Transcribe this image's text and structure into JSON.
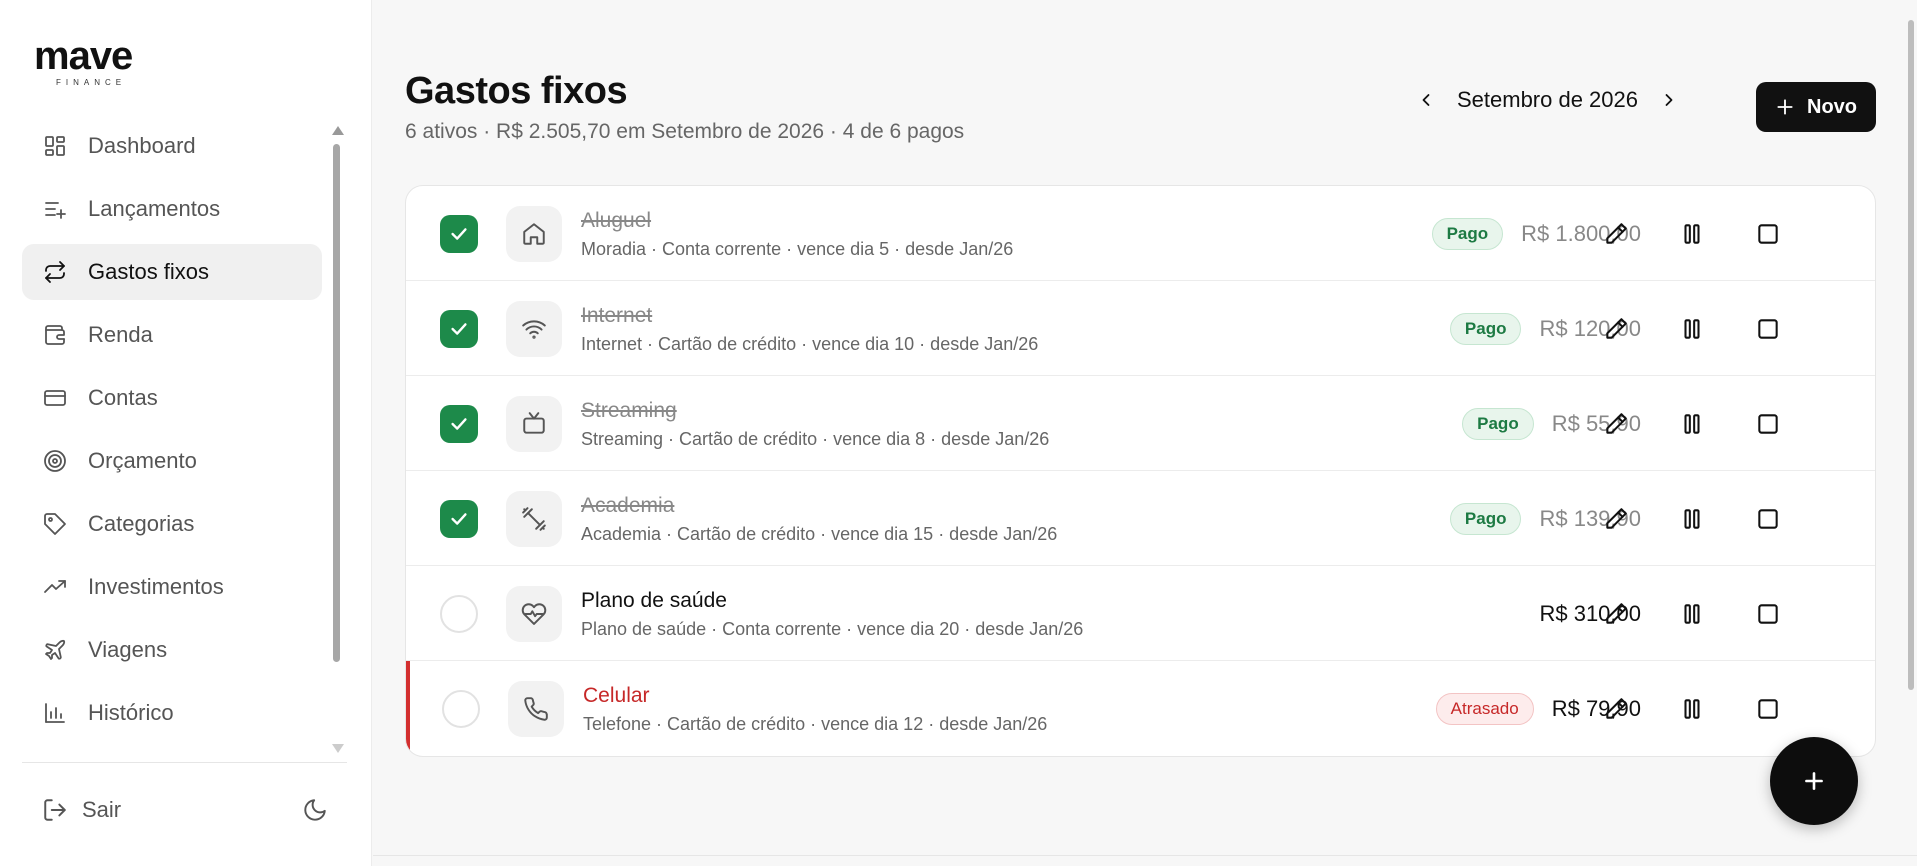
{
  "sidebar": {
    "logo_text": "mave",
    "logo_sub": "FINANCE",
    "items": [
      {
        "label": "Dashboard",
        "icon": "dashboard-icon"
      },
      {
        "label": "Lançamentos",
        "icon": "list-plus-icon"
      },
      {
        "label": "Gastos fixos",
        "icon": "repeat-icon",
        "active": true
      },
      {
        "label": "Renda",
        "icon": "wallet-icon"
      },
      {
        "label": "Contas",
        "icon": "credit-card-icon"
      },
      {
        "label": "Orçamento",
        "icon": "target-icon"
      },
      {
        "label": "Categorias",
        "icon": "tag-icon"
      },
      {
        "label": "Investimentos",
        "icon": "trending-up-icon"
      },
      {
        "label": "Viagens",
        "icon": "plane-icon"
      },
      {
        "label": "Histórico",
        "icon": "bar-chart-icon"
      }
    ],
    "logout_label": "Sair"
  },
  "header": {
    "title": "Gastos fixos",
    "subtitle": "6 ativos · R$ 2.505,70 em Setembro de 2026 · 4 de 6 pagos",
    "month": "Setembro de 2026",
    "new_label": "Novo"
  },
  "expenses": [
    {
      "name": "Aluguel",
      "detail": "Moradia · Conta corrente · vence dia 5 · desde Jan/26",
      "status": "Pago",
      "amount": "R$ 1.800,00",
      "paid": true,
      "icon": "home-icon"
    },
    {
      "name": "Internet",
      "detail": "Internet · Cartão de crédito · vence dia 10 · desde Jan/26",
      "status": "Pago",
      "amount": "R$ 120,00",
      "paid": true,
      "icon": "wifi-icon"
    },
    {
      "name": "Streaming",
      "detail": "Streaming · Cartão de crédito · vence dia 8 · desde Jan/26",
      "status": "Pago",
      "amount": "R$ 55,90",
      "paid": true,
      "icon": "tv-icon"
    },
    {
      "name": "Academia",
      "detail": "Academia · Cartão de crédito · vence dia 15 · desde Jan/26",
      "status": "Pago",
      "amount": "R$ 139,90",
      "paid": true,
      "icon": "dumbbell-icon"
    },
    {
      "name": "Plano de saúde",
      "detail": "Plano de saúde · Conta corrente · vence dia 20 · desde Jan/26",
      "status": "",
      "amount": "R$ 310,00",
      "paid": false,
      "icon": "heart-pulse-icon"
    },
    {
      "name": "Celular",
      "detail": "Telefone · Cartão de crédito · vence dia 12 · desde Jan/26",
      "status": "Atrasado",
      "amount": "R$ 79,90",
      "paid": false,
      "icon": "phone-icon"
    }
  ],
  "colors": {
    "accent": "#111111",
    "paid_green": "#1d8a4a",
    "overdue_red": "#c62828"
  }
}
